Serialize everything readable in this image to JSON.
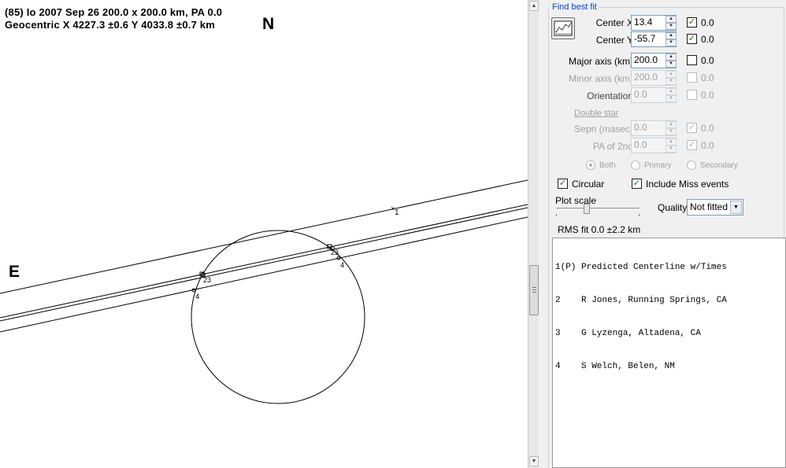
{
  "plot": {
    "header_line1": "(85) Io  2007 Sep 26  200.0 x 200.0 km,  PA 0.0",
    "header_line2": "Geocentric  X  4227.3 ±0.6  Y 4033.8 ±0.7 km",
    "north": "N",
    "east": "E",
    "labels": {
      "chord1": "1",
      "chord23_left": "23",
      "chord4_left": "4",
      "chord23_right": "23",
      "chord4_right": "4"
    }
  },
  "panel": {
    "group_title": "Find best fit",
    "fit_button_icon": "fit-chart-icon",
    "fields": [
      {
        "label": "Center X",
        "value": "13.4",
        "checked": true,
        "check_value": "0.0",
        "enabled": true
      },
      {
        "label": "Center Y",
        "value": "-55.7",
        "checked": true,
        "check_value": "0.0",
        "enabled": true
      },
      {
        "label": "Major axis (km)",
        "value": "200.0",
        "checked": false,
        "check_value": "0.0",
        "enabled": true
      },
      {
        "label": "Minor axis (km)",
        "value": "200.0",
        "checked": false,
        "check_value": "0.0",
        "enabled": false
      },
      {
        "label": "Orientation",
        "value": "0.0",
        "checked": false,
        "check_value": "0.0",
        "enabled": false
      }
    ],
    "double_star": {
      "label": "Double star",
      "sepn": {
        "label": "Sepn (masec)",
        "value": "0.0",
        "check_value": "0.0"
      },
      "pa2": {
        "label": "PA of 2nd",
        "value": "0.0",
        "check_value": "0.0"
      },
      "radios": [
        "Both",
        "Primary",
        "Secondary"
      ]
    },
    "circular": "Circular",
    "include_miss": "Include Miss events",
    "plot_scale": "Plot scale",
    "quality_label": "Quality",
    "quality_value": "Not fitted",
    "rms": "RMS fit 0.0 ±2.2 km",
    "list": [
      "1(P) Predicted Centerline w/Times",
      "2    R Jones, Running Springs, CA",
      "3    G Lyzenga, Altadena, CA",
      "4    S Welch, Belen, NM"
    ]
  }
}
